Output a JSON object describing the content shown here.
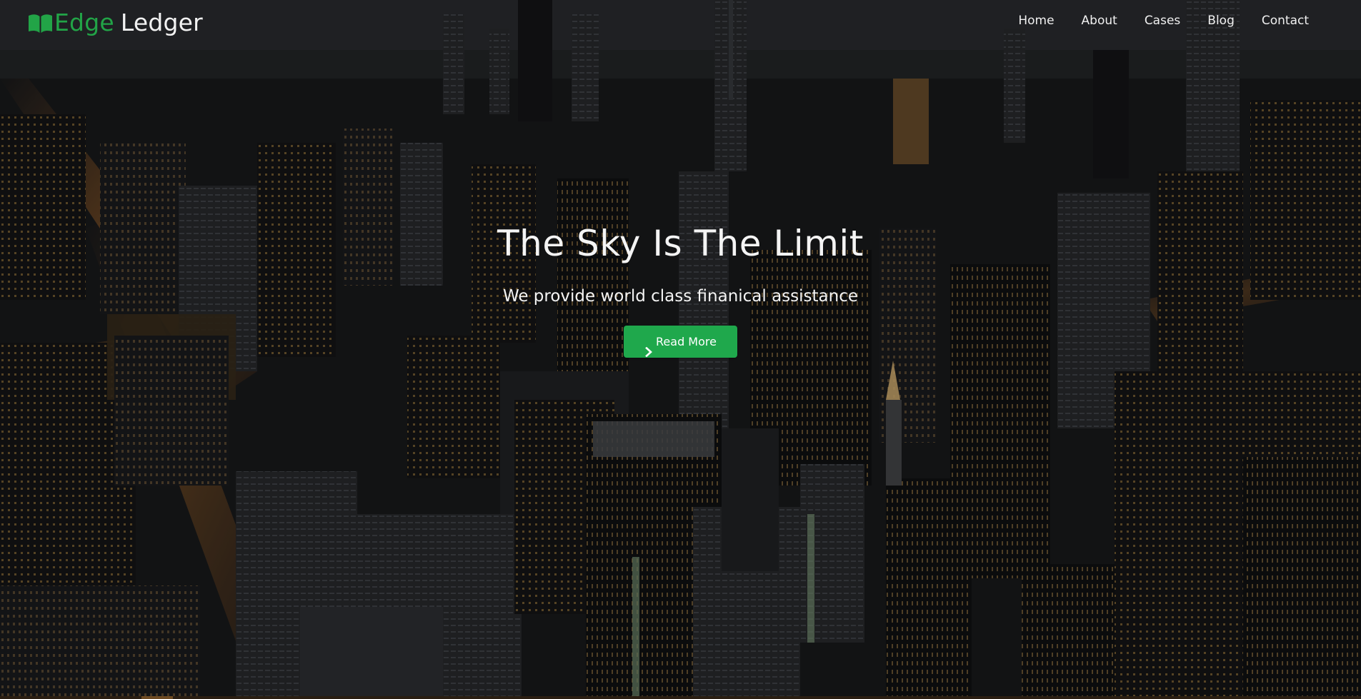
{
  "brand": {
    "icon": "book-open-icon",
    "word_1": "Edge",
    "word_2": "Ledger",
    "accent_color": "#22a447"
  },
  "nav": {
    "items": [
      {
        "label": "Home"
      },
      {
        "label": "About"
      },
      {
        "label": "Cases"
      },
      {
        "label": "Blog"
      },
      {
        "label": "Contact"
      }
    ]
  },
  "hero": {
    "title": "The Sky Is The Limit",
    "subtitle": "We provide world class finanical assistance",
    "button": {
      "icon": "chevron-right-icon",
      "label": "Read More",
      "color": "#1fa84c"
    },
    "background": "night-city-skyline-photo"
  }
}
